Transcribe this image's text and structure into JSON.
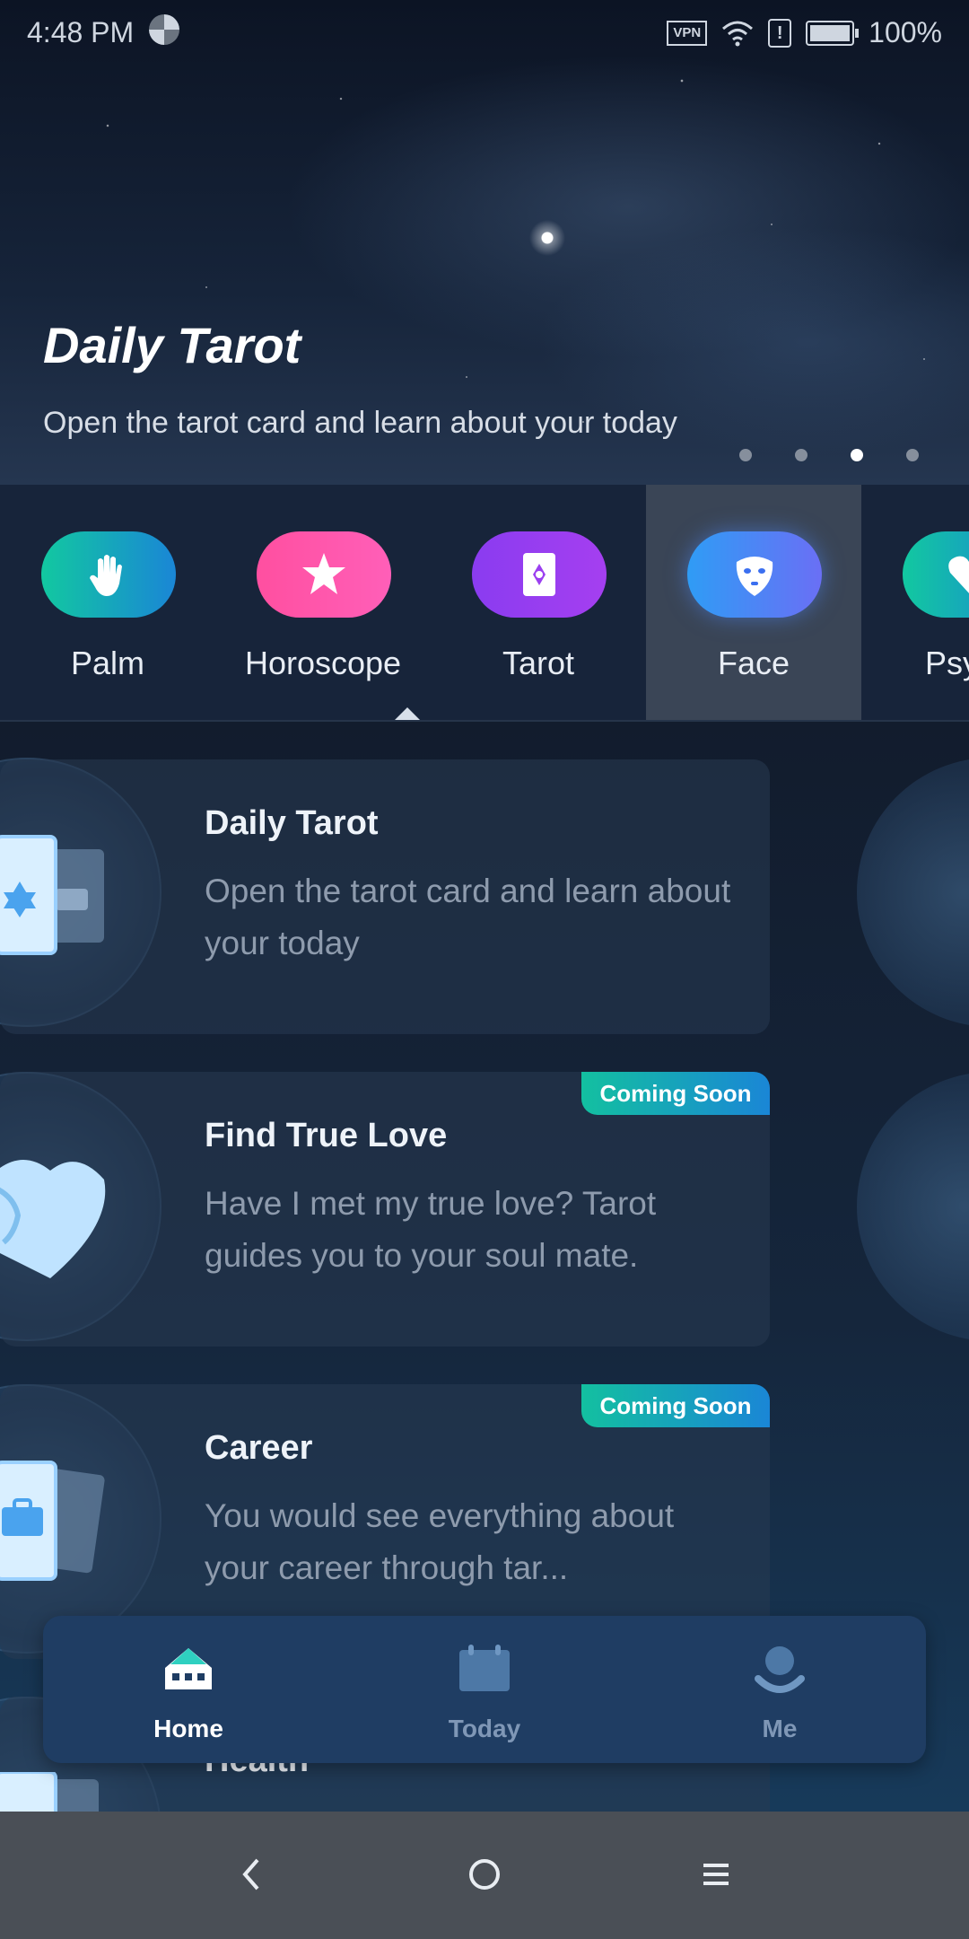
{
  "status_bar": {
    "time": "4:48 PM",
    "vpn": "VPN",
    "battery": "100%"
  },
  "hero": {
    "title": "Daily Tarot",
    "subtitle": "Open the tarot card and learn about your today",
    "active_slide": 3,
    "slide_count": 4
  },
  "categories": [
    {
      "label": "Palm",
      "icon": "hand-icon",
      "color": "#13b7a0"
    },
    {
      "label": "Horoscope",
      "icon": "star-icon",
      "color": "#ff4fa0"
    },
    {
      "label": "Tarot",
      "icon": "tarot-card-icon",
      "color": "#9b3ff0"
    },
    {
      "label": "Face",
      "icon": "face-mask-icon",
      "color": "#3b82f6"
    },
    {
      "label": "Psych",
      "icon": "heart-icon",
      "color": "#13b7a0"
    }
  ],
  "cards": [
    {
      "title": "Daily Tarot",
      "desc": "Open the tarot card and learn about your today",
      "badge": ""
    },
    {
      "title": "Find True Love",
      "desc": "Have I met my true love? Tarot guides you to your soul mate.",
      "badge": "Coming Soon"
    },
    {
      "title": "Career",
      "desc": "You would see everything about your career through tar...",
      "badge": "Coming Soon"
    },
    {
      "title": "Health",
      "desc": "",
      "badge": ""
    }
  ],
  "tabs": [
    {
      "label": "Home",
      "active": true
    },
    {
      "label": "Today",
      "active": false
    },
    {
      "label": "Me",
      "active": false
    }
  ]
}
